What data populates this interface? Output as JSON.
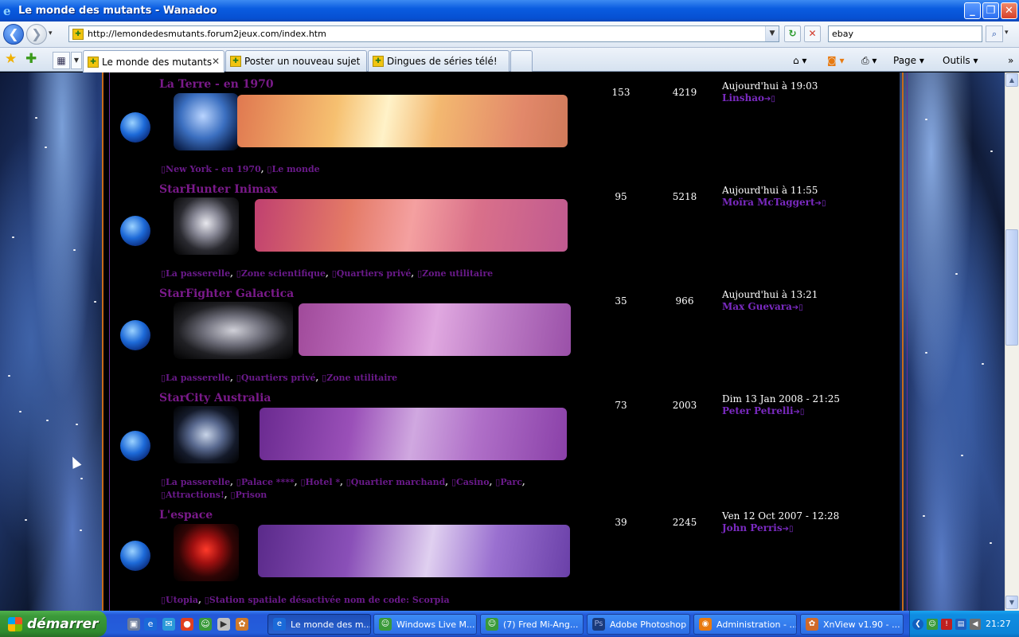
{
  "window": {
    "title": "Le monde des mutants - Wanadoo",
    "min": "_",
    "max": "❐",
    "close": "✕"
  },
  "navbar": {
    "back_icon": "❮",
    "forward_icon": "❯",
    "history_icon": "▾",
    "url": "http://lemondedesmutants.forum2jeux.com/index.htm",
    "refresh_icon": "↻",
    "stop_icon": "✕",
    "search_value": "ebay",
    "search_icon": "⌕",
    "search_dd": "▾"
  },
  "tabs": [
    {
      "label": "Le monde des mutants",
      "close": "✕"
    },
    {
      "label": "Poster un nouveau sujet"
    },
    {
      "label": "Dingues de séries télé!"
    }
  ],
  "toolbar": {
    "home": "⌂ ▾",
    "rss": "◙ ▾",
    "print": "⎙ ▾",
    "page": "Page ▾",
    "tools": "Outils ▾",
    "more": "»"
  },
  "forums": [
    {
      "name": "La Terre - en 1970",
      "subforums": [
        "New York - en 1970",
        "Le monde"
      ],
      "topics": "153",
      "posts": "4219",
      "last_date": "Aujourd'hui à 19:03",
      "last_author": "Linshao",
      "colors": {
        "banner": "#f0a060"
      }
    },
    {
      "name": "StarHunter Inimax",
      "subforums": [
        "La passerelle",
        "Zone scientifique",
        "Quartiers privé",
        "Zone utilitaire"
      ],
      "topics": "95",
      "posts": "5218",
      "last_date": "Aujourd'hui à 11:55",
      "last_author": "Moïra McTaggert",
      "colors": {
        "banner": "#d86a70"
      }
    },
    {
      "name": "StarFighter Galactica",
      "subforums": [
        "La passerelle",
        "Quartiers privé",
        "Zone utilitaire"
      ],
      "topics": "35",
      "posts": "966",
      "last_date": "Aujourd'hui à 13:21",
      "last_author": "Max Guevara",
      "colors": {
        "banner": "#b85aa8"
      }
    },
    {
      "name": "StarCity Australia",
      "subforums": [
        "La passerelle",
        "Palace ****",
        "Hotel *",
        "Quartier marchand",
        "Casino",
        "Parc",
        "Attractions!",
        "Prison"
      ],
      "topics": "73",
      "posts": "2003",
      "last_date": "Dim 13 Jan 2008 - 21:25",
      "last_author": "Peter Petrelli",
      "colors": {
        "banner": "#9a4ab0"
      }
    },
    {
      "name": "L'espace",
      "subforums": [
        "Utopia",
        "Station spatiale désactivée nom de code: Scorpia"
      ],
      "topics": "39",
      "posts": "2245",
      "last_date": "Ven 12 Oct 2007 - 12:28",
      "last_author": "John Perris",
      "colors": {
        "banner": "#8a4ab8"
      }
    }
  ],
  "taskbar": {
    "start": "démarrer",
    "tasks": [
      "Le monde des m...",
      "Windows Live M...",
      "(7) Fred Mi-Ang...",
      "Adobe Photoshop",
      "Administration - ...",
      "XnView v1.90 - ..."
    ],
    "clock": "21:27"
  }
}
